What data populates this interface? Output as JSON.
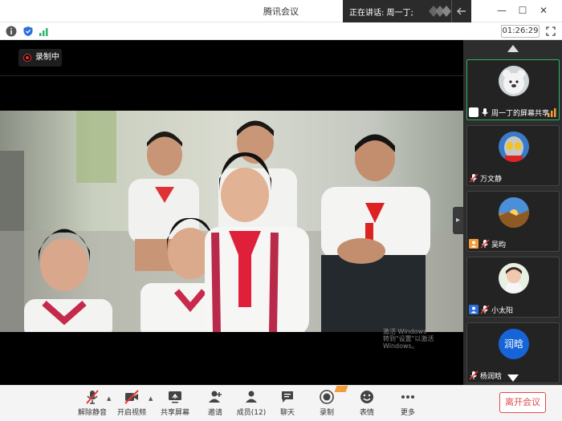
{
  "window": {
    "title": "腾讯会议",
    "speaking_label": "正在讲话: 周一丁;",
    "minimize": "—",
    "maximize": "☐",
    "close": "✕"
  },
  "infobar": {
    "timer": "01:26:29"
  },
  "stage": {
    "recording_label": "录制中",
    "watermark_line1": "激活 Windows",
    "watermark_line2": "转到\"设置\"以激活 Windows。"
  },
  "participants": [
    {
      "name": "周一丁的屏幕共享",
      "avatar": "cartoon-bear-avatar",
      "active": true,
      "sharing": true,
      "muted": false
    },
    {
      "name": "万文静",
      "avatar": "cartoon-hero-avatar",
      "active": false,
      "sharing": false,
      "muted": true
    },
    {
      "name": "吴昀",
      "avatar": "landscape-avatar",
      "active": false,
      "sharing": false,
      "muted": true
    },
    {
      "name": "小太阳",
      "avatar": "child-photo-avatar",
      "active": false,
      "sharing": false,
      "muted": true
    },
    {
      "name": "杨润晗",
      "avatar_text": "润晗",
      "active": false,
      "sharing": false,
      "muted": true
    }
  ],
  "toolbar": {
    "unmute": "解除静音",
    "start_video": "开启视频",
    "share_screen": "共享屏幕",
    "invite": "邀请",
    "members": "成员(12)",
    "chat": "聊天",
    "record": "录制",
    "emoji": "表情",
    "more": "更多",
    "leave": "离开会议"
  },
  "colors": {
    "accent_green": "#2ab56a",
    "leave_red": "#e24b4b",
    "record_badge": "#f39c3a"
  }
}
